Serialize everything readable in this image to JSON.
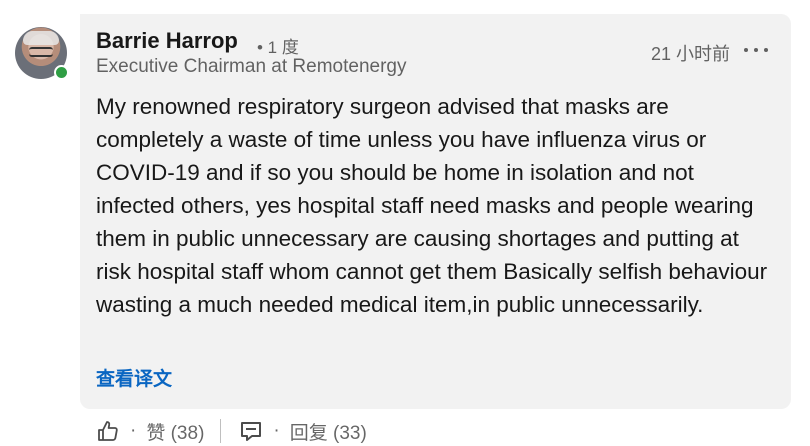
{
  "comment": {
    "author": {
      "name": "Barrie Harrop",
      "degree": "• 1 度",
      "headline": "Executive Chairman at Remotenergy",
      "online": true
    },
    "timestamp": "21 小时前",
    "more_icon": "ellipsis-horizontal-icon",
    "text": "My renowned respiratory surgeon advised that masks are completely a waste of time unless you have influenza virus or COVID-19 and if so you should be home in isolation and not infected others, yes hospital staff need masks and people wearing them in public unnecessary are causing shortages and putting at risk hospital staff whom cannot get them Basically selfish behaviour wasting a much needed medical item,in public unnecessarily.",
    "translate_label": "查看译文",
    "actions": {
      "like": {
        "icon": "thumbs-up-icon",
        "separator": "·",
        "label": "赞 (38)"
      },
      "reply": {
        "icon": "comment-icon",
        "separator": "·",
        "label": "回复 (33)"
      }
    }
  },
  "colors": {
    "bubble": "#f2f2f2",
    "link": "#0a66c2",
    "presence": "#2f9e44",
    "text_primary": "rgba(0,0,0,0.9)",
    "text_secondary": "rgba(0,0,0,0.6)"
  }
}
